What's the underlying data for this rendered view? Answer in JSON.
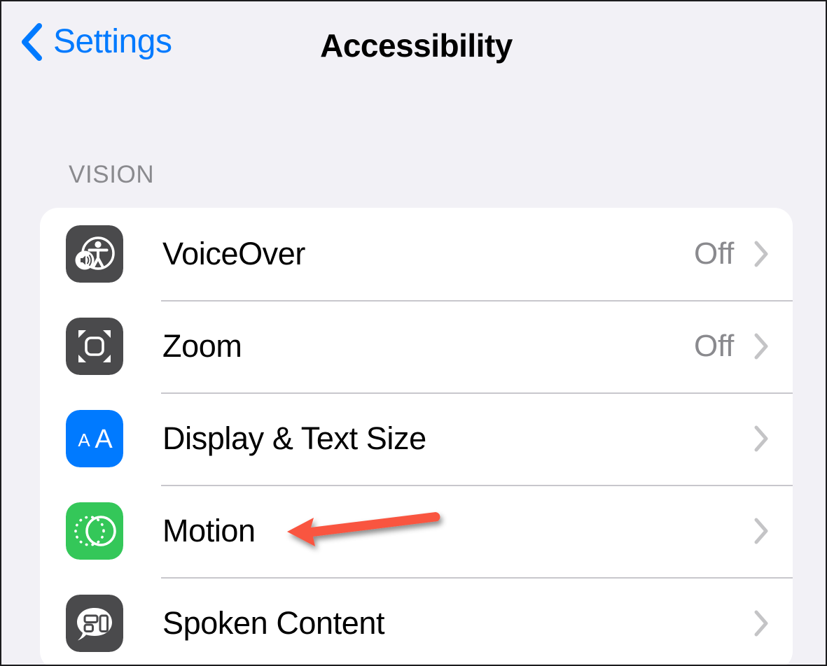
{
  "navbar": {
    "back_label": "Settings",
    "back_icon": "chevron-left-icon",
    "title": "Accessibility"
  },
  "sections": [
    {
      "header": "VISION",
      "rows": [
        {
          "label": "VoiceOver",
          "value": "Off",
          "icon": "voiceover-icon",
          "icon_bg": "#4a4a4c",
          "chevron": "chevron-right-icon"
        },
        {
          "label": "Zoom",
          "value": "Off",
          "icon": "zoom-icon",
          "icon_bg": "#4a4a4c",
          "chevron": "chevron-right-icon"
        },
        {
          "label": "Display & Text Size",
          "value": "",
          "icon": "display-text-size-icon",
          "icon_bg": "#007aff",
          "chevron": "chevron-right-icon"
        },
        {
          "label": "Motion",
          "value": "",
          "icon": "motion-icon",
          "icon_bg": "#34c759",
          "chevron": "chevron-right-icon"
        },
        {
          "label": "Spoken Content",
          "value": "",
          "icon": "spoken-content-icon",
          "icon_bg": "#4a4a4c",
          "chevron": "chevron-right-icon"
        }
      ]
    }
  ],
  "annotation": {
    "type": "arrow",
    "color": "#f9543f",
    "points_to": "Motion"
  },
  "colors": {
    "background": "#f2f1f6",
    "card": "#ffffff",
    "accent_blue": "#007aff",
    "separator": "#c8c7cc",
    "secondary_text": "#8a8a8e"
  }
}
